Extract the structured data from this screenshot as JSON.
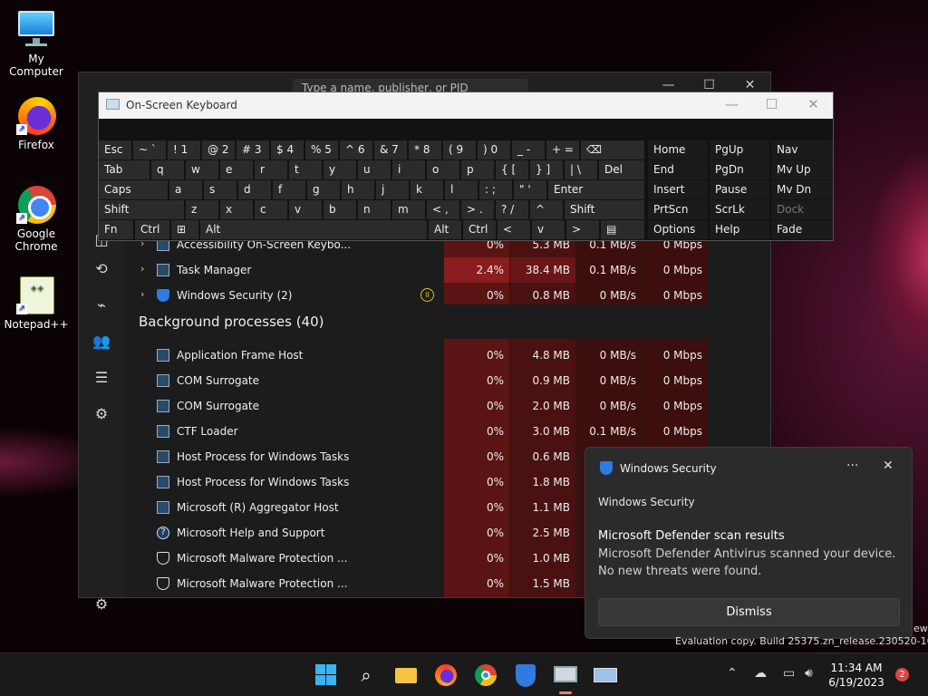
{
  "desktop": {
    "icons": [
      {
        "label": "My Computer"
      },
      {
        "label": "Firefox"
      },
      {
        "label": "Google Chrome"
      },
      {
        "label": "Notepad++"
      }
    ]
  },
  "task_manager": {
    "search_placeholder": "Type a name, publisher, or PID",
    "section_background": "Background processes (40)",
    "apps": [
      {
        "name": "Accessibility On-Screen Keybo...",
        "cpu": "0%",
        "mem": "5.3 MB",
        "disk": "0.1 MB/s",
        "net": "0 Mbps"
      },
      {
        "name": "Task Manager",
        "cpu": "2.4%",
        "mem": "38.4 MB",
        "disk": "0.1 MB/s",
        "net": "0 Mbps"
      },
      {
        "name": "Windows Security (2)",
        "cpu": "0%",
        "mem": "0.8 MB",
        "disk": "0 MB/s",
        "net": "0 Mbps"
      }
    ],
    "background": [
      {
        "name": "Application Frame Host",
        "cpu": "0%",
        "mem": "4.8 MB",
        "disk": "0 MB/s",
        "net": "0 Mbps"
      },
      {
        "name": "COM Surrogate",
        "cpu": "0%",
        "mem": "0.9 MB",
        "disk": "0 MB/s",
        "net": "0 Mbps"
      },
      {
        "name": "COM Surrogate",
        "cpu": "0%",
        "mem": "2.0 MB",
        "disk": "0 MB/s",
        "net": "0 Mbps"
      },
      {
        "name": "CTF Loader",
        "cpu": "0%",
        "mem": "3.0 MB",
        "disk": "0.1 MB/s",
        "net": "0 Mbps"
      },
      {
        "name": "Host Process for Windows Tasks",
        "cpu": "0%",
        "mem": "0.6 MB"
      },
      {
        "name": "Host Process for Windows Tasks",
        "cpu": "0%",
        "mem": "1.8 MB"
      },
      {
        "name": "Microsoft (R) Aggregator Host",
        "cpu": "0%",
        "mem": "1.1 MB"
      },
      {
        "name": "Microsoft Help and Support",
        "cpu": "0%",
        "mem": "2.5 MB"
      },
      {
        "name": "Microsoft Malware Protection ...",
        "cpu": "0%",
        "mem": "1.0 MB"
      },
      {
        "name": "Microsoft Malware Protection ...",
        "cpu": "0%",
        "mem": "1.5 MB"
      }
    ]
  },
  "osk": {
    "title": "On-Screen Keyboard",
    "row1": {
      "esc": "Esc",
      "tilde": "~ `",
      "n1": "! 1",
      "n2": "@ 2",
      "n3": "# 3",
      "n4": "$ 4",
      "n5": "% 5",
      "n6": "^ 6",
      "n7": "& 7",
      "n8": "* 8",
      "n9": "( 9",
      "n0": ") 0",
      "minus": "_ -",
      "equal": "+ =",
      "bksp": "⌫"
    },
    "row2": {
      "tab": "Tab",
      "q": "q",
      "w": "w",
      "e": "e",
      "r": "r",
      "t": "t",
      "y": "y",
      "u": "u",
      "i": "i",
      "o": "o",
      "p": "p",
      "lbr": "{ [",
      "rbr": "} ]",
      "bsl": "| \\",
      "del": "Del"
    },
    "row3": {
      "caps": "Caps",
      "a": "a",
      "s": "s",
      "d": "d",
      "f": "f",
      "g": "g",
      "h": "h",
      "j": "j",
      "k": "k",
      "l": "l",
      "semi": ": ;",
      "quote": "\" '",
      "enter": "Enter"
    },
    "row4": {
      "shift": "Shift",
      "z": "z",
      "x": "x",
      "c": "c",
      "v": "v",
      "b": "b",
      "n": "n",
      "m": "m",
      "comma": "< ,",
      "period": "> .",
      "slash": "? /",
      "up": "^",
      "rshift": "Shift"
    },
    "row5": {
      "fn": "Fn",
      "ctrl": "Ctrl",
      "win": "⊞",
      "alt": "Alt",
      "ralt": "Alt",
      "rctrl": "Ctrl",
      "left": "<",
      "down": "v",
      "right": ">",
      "menu": "▤"
    },
    "nav": {
      "home": "Home",
      "pgup": "PgUp",
      "navk": "Nav",
      "end": "End",
      "pgdn": "PgDn",
      "mvup": "Mv Up",
      "insert": "Insert",
      "pause": "Pause",
      "mvdn": "Mv Dn",
      "prtscn": "PrtScn",
      "scrlk": "ScrLk",
      "dock": "Dock",
      "options": "Options",
      "help": "Help",
      "fade": "Fade"
    }
  },
  "toast": {
    "header": "Windows Security",
    "app_name": "Windows Security",
    "title": "Microsoft Defender scan results",
    "body_line1": "Microsoft Defender Antivirus scanned your device.",
    "body_line2": "No new threats were found.",
    "dismiss": "Dismiss",
    "more": "···",
    "close": "✕"
  },
  "watermark": {
    "line1_fragment": "ew",
    "line2": "Evaluation copy. Build 25375.zn_release.230520-1632"
  },
  "taskbar": {
    "time": "11:34 AM",
    "date": "6/19/2023",
    "notification_count": "2"
  },
  "colors": {
    "accent": "#3ab4f2",
    "heat_high": "#8a1d1d",
    "heat_low": "#5a1414",
    "badge": "#e0443f"
  }
}
